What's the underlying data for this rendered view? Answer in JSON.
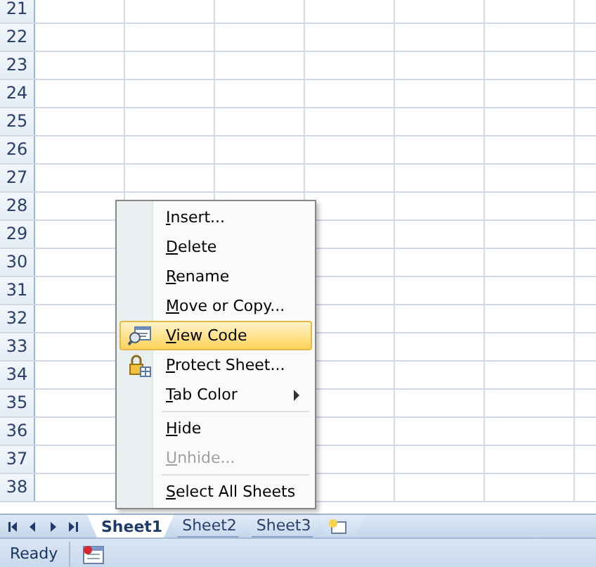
{
  "sheet": {
    "row_headers": [
      "21",
      "22",
      "23",
      "24",
      "25",
      "26",
      "27",
      "28",
      "29",
      "30",
      "31",
      "32",
      "33",
      "34",
      "35",
      "36",
      "37",
      "38"
    ]
  },
  "context_menu": {
    "items": [
      {
        "kind": "item",
        "label": "Insert...",
        "selected": false,
        "disabled": false,
        "submenu": false
      },
      {
        "kind": "item",
        "label": "Delete",
        "selected": false,
        "disabled": false,
        "submenu": false
      },
      {
        "kind": "item",
        "label": "Rename",
        "selected": false,
        "disabled": false,
        "submenu": false
      },
      {
        "kind": "item",
        "label": "Move or Copy...",
        "selected": false,
        "disabled": false,
        "submenu": false
      },
      {
        "kind": "code-item",
        "label": "View Code",
        "selected": true,
        "disabled": false,
        "submenu": false
      },
      {
        "kind": "lock-item",
        "label": "Protect Sheet...",
        "selected": false,
        "disabled": false,
        "submenu": false
      },
      {
        "kind": "item",
        "label": "Tab Color",
        "selected": false,
        "disabled": false,
        "submenu": true
      },
      {
        "kind": "separator"
      },
      {
        "kind": "item",
        "label": "Hide",
        "selected": false,
        "disabled": false,
        "submenu": false
      },
      {
        "kind": "item",
        "label": "Unhide...",
        "selected": false,
        "disabled": true,
        "submenu": false
      },
      {
        "kind": "separator"
      },
      {
        "kind": "item",
        "label": "Select All Sheets",
        "selected": false,
        "disabled": false,
        "submenu": false
      }
    ]
  },
  "sheet_tabs": [
    {
      "label": "Sheet1",
      "selected": true
    },
    {
      "label": "Sheet2",
      "selected": false
    },
    {
      "label": "Sheet3",
      "selected": false
    }
  ],
  "status_bar": {
    "status": "Ready"
  }
}
